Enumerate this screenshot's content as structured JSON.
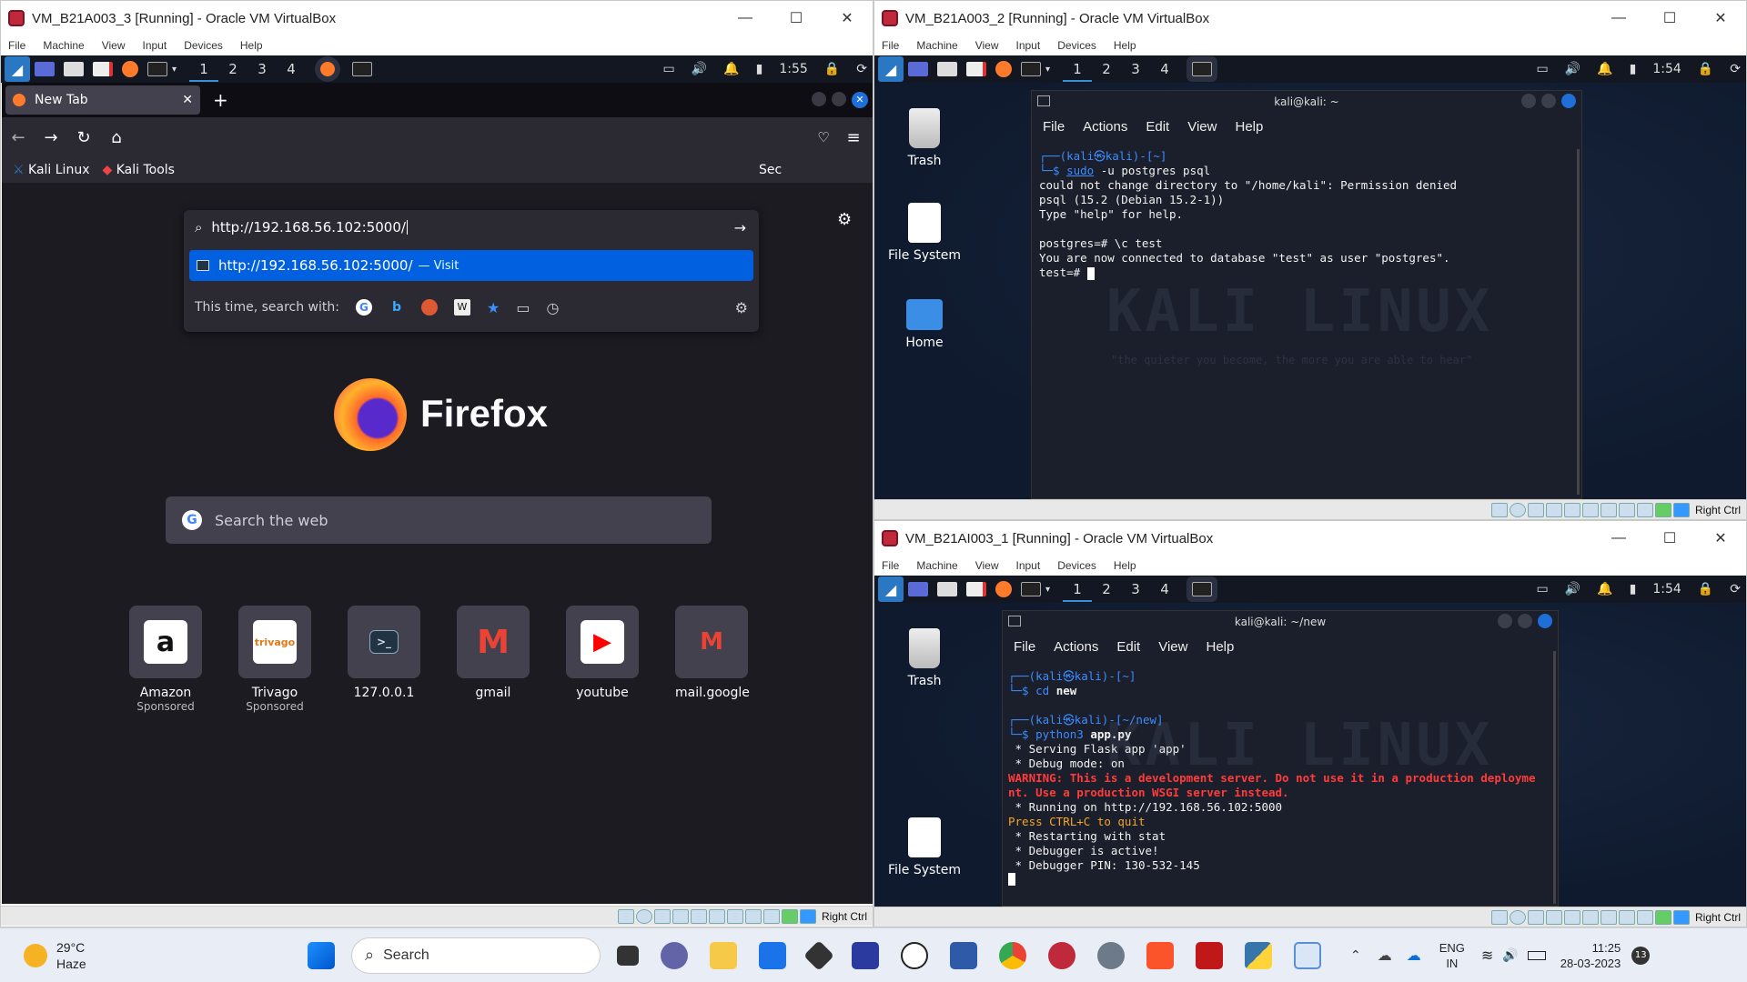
{
  "vm_left": {
    "title": "VM_B21A003_3 [Running] - Oracle VM VirtualBox",
    "menu": [
      "File",
      "Machine",
      "View",
      "Input",
      "Devices",
      "Help"
    ],
    "workspaces": [
      "1",
      "2",
      "3",
      "4"
    ],
    "clock": "1:55",
    "status_host_key": "Right Ctrl",
    "firefox": {
      "tab_label": "New Tab",
      "new_tab": "+",
      "url_value": "http://192.168.56.102:5000/",
      "suggestion_url": "http://192.168.56.102:5000/",
      "suggestion_action": "— Visit",
      "search_with_label": "This time, search with:",
      "bookmarks": [
        "Kali Linux",
        "Kali Tools"
      ],
      "bookmark_overflow": "Sec",
      "brand": "Firefox",
      "search_placeholder": "Search the web",
      "tiles": [
        {
          "label": "Amazon",
          "sub": "Sponsored",
          "glyph": "a"
        },
        {
          "label": "Trivago",
          "sub": "Sponsored",
          "glyph": "trivago"
        },
        {
          "label": "127.0.0.1",
          "sub": "",
          "glyph": ">_"
        },
        {
          "label": "gmail",
          "sub": "",
          "glyph": "M"
        },
        {
          "label": "youtube",
          "sub": "",
          "glyph": "▶"
        },
        {
          "label": "mail.google",
          "sub": "",
          "glyph": "M"
        }
      ]
    }
  },
  "vm_top_right": {
    "title": "VM_B21A003_2 [Running] - Oracle VM VirtualBox",
    "menu": [
      "File",
      "Machine",
      "View",
      "Input",
      "Devices",
      "Help"
    ],
    "workspaces": [
      "1",
      "2",
      "3",
      "4"
    ],
    "clock": "1:54",
    "status_host_key": "Right Ctrl",
    "desktop_icons": [
      "Trash",
      "File System",
      "Home"
    ],
    "terminal": {
      "title": "kali@kali: ~",
      "menu": [
        "File",
        "Actions",
        "Edit",
        "View",
        "Help"
      ],
      "lines": {
        "l1": "┌──(kali㉿kali)-[~]",
        "l2p": "└─$ ",
        "l2a": "sudo",
        "l2b": " -u postgres psql",
        "l3": "could not change directory to \"/home/kali\": Permission denied",
        "l4": "psql (15.2 (Debian 15.2-1))",
        "l5": "Type \"help\" for help.",
        "l6": "postgres=# \\c test",
        "l7": "You are now connected to database \"test\" as user \"postgres\".",
        "l8": "test=# "
      }
    },
    "watermark": "KALI LINUX",
    "watermark_sub": "\"the quieter you become, the more you are able to hear\""
  },
  "vm_bottom_right": {
    "title": "VM_B21AI003_1 [Running] - Oracle VM VirtualBox",
    "menu": [
      "File",
      "Machine",
      "View",
      "Input",
      "Devices",
      "Help"
    ],
    "workspaces": [
      "1",
      "2",
      "3",
      "4"
    ],
    "clock": "1:54",
    "status_host_key": "Right Ctrl",
    "desktop_icons": [
      "Trash",
      "File System"
    ],
    "terminal": {
      "title": "kali@kali: ~/new",
      "menu": [
        "File",
        "Actions",
        "Edit",
        "View",
        "Help"
      ],
      "lines": {
        "l1": "┌──(kali㉿kali)-[~]",
        "l2p": "└─$ ",
        "l2a": "cd",
        "l2b": " new",
        "l3": "┌──(kali㉿kali)-[~/new]",
        "l4p": "└─$ ",
        "l4a": "python3",
        "l4b": " app.py",
        "l5": " * Serving Flask app 'app'",
        "l6": " * Debug mode: on",
        "l7": "WARNING: This is a development server. Do not use it in a production deployme",
        "l8": "nt. Use a production WSGI server instead.",
        "l9": " * Running on http://192.168.56.102:5000",
        "l10": "Press CTRL+C to quit",
        "l11": " * Restarting with stat",
        "l12": " * Debugger is active!",
        "l13": " * Debugger PIN: 130-532-145"
      }
    }
  },
  "taskbar": {
    "weather_temp": "29°C",
    "weather_desc": "Haze",
    "search_label": "Search",
    "lang1": "ENG",
    "lang2": "IN",
    "time": "11:25",
    "date": "28-03-2023",
    "notif_count": "13"
  }
}
